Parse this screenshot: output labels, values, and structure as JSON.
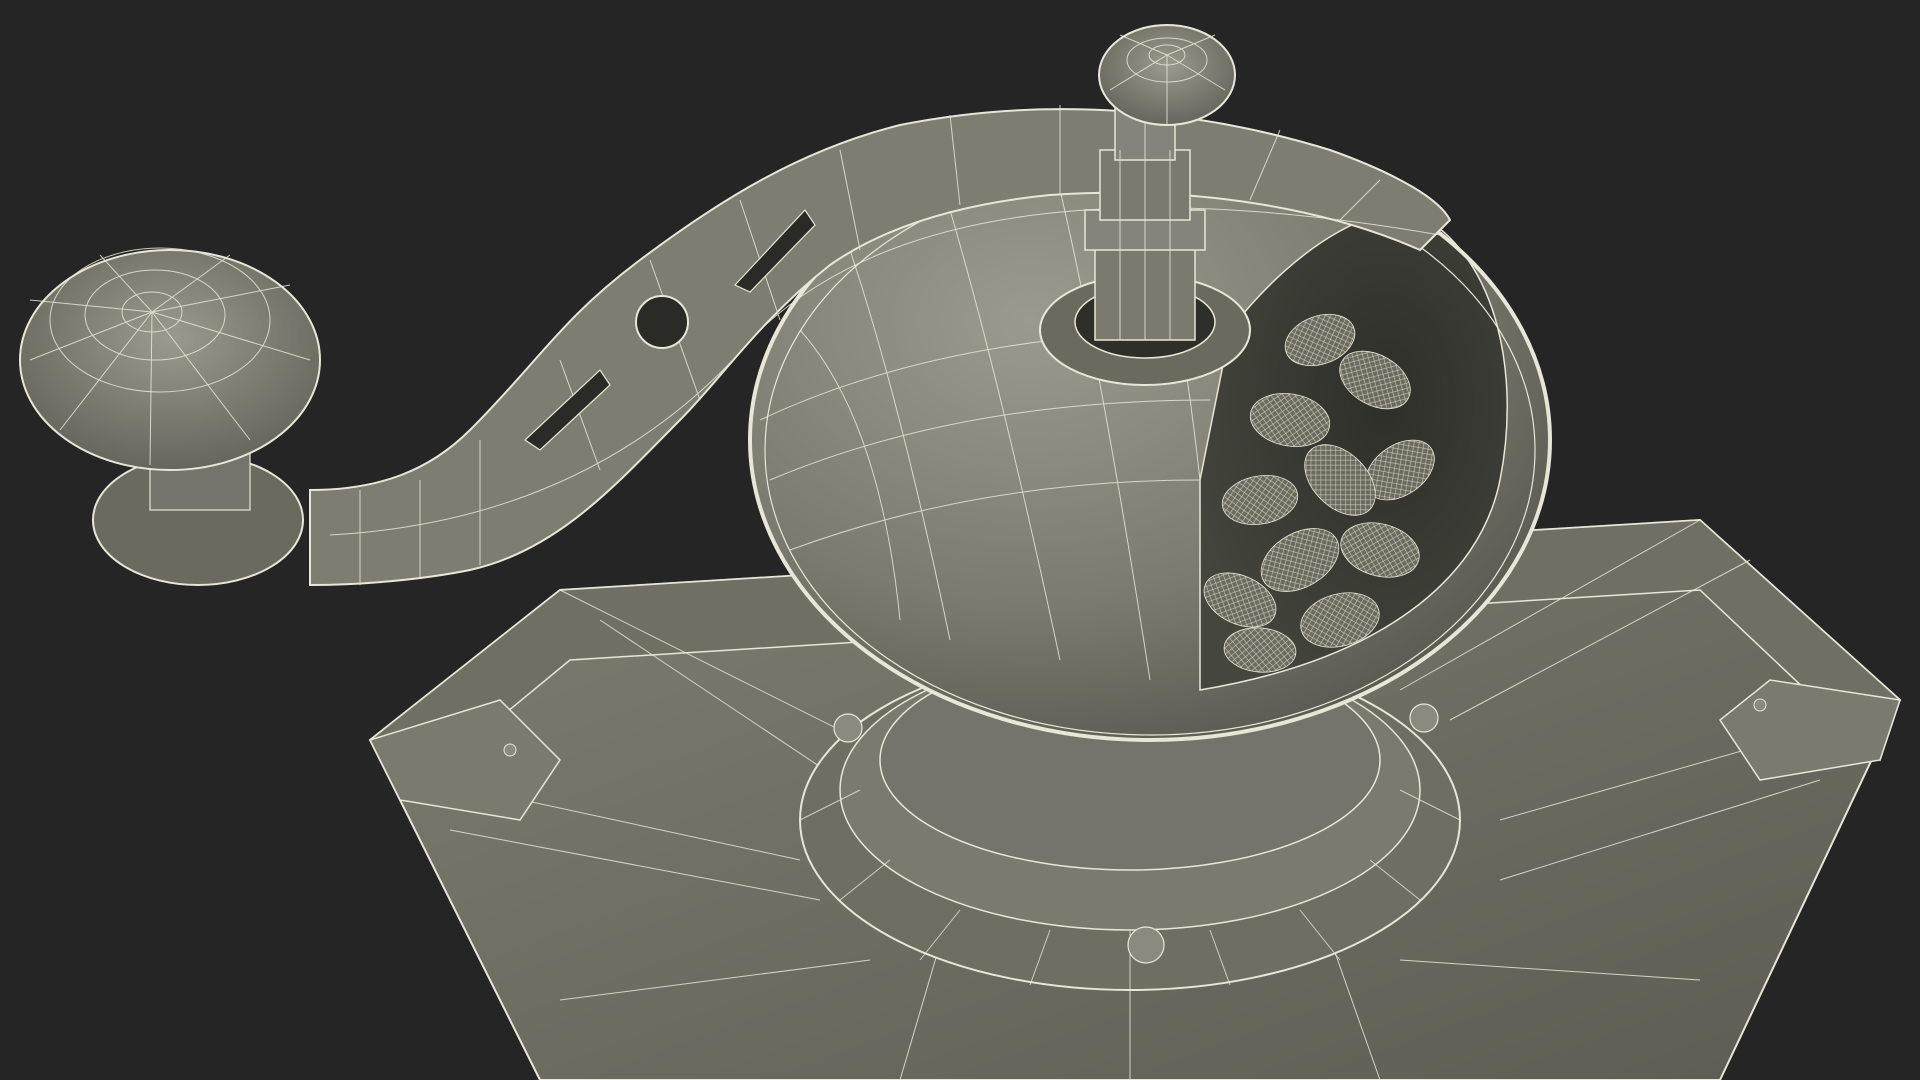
{
  "scene": {
    "subject": "wireframe-render-manual-coffee-grinder",
    "colors": {
      "background": "#252525",
      "surface": "#6b6b60",
      "surface_light": "#8a8a7e",
      "surface_dark": "#4a4a42",
      "wire": "#e8e6d6",
      "cavity": "#3a3b34",
      "beans": "#5a5a50"
    },
    "icons": []
  }
}
